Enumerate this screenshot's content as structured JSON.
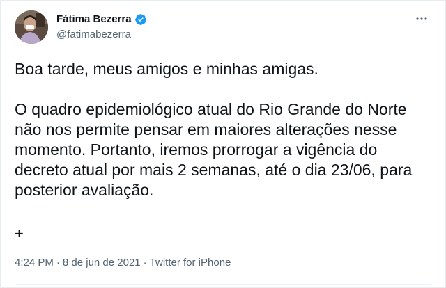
{
  "author": {
    "display_name": "Fátima Bezerra",
    "handle": "@fatimabezerra",
    "verified_icon": "verified-badge-icon",
    "avatar_icon": "avatar"
  },
  "tweet": {
    "paragraphs": [
      "Boa tarde, meus amigos e minhas amigas.",
      "O quadro epidemiológico atual do Rio Grande do Norte não nos permite pensar em maiores alterações nesse momento. Portanto, iremos prorrogar a vigência do decreto atual por mais 2 semanas, até o dia 23/06, para posterior avaliação."
    ],
    "thread_marker": "+"
  },
  "meta": {
    "time": "4:24 PM",
    "separator": "·",
    "date": "8 de jun de 2021",
    "source": "Twitter for iPhone"
  },
  "colors": {
    "verified_blue": "#1d9bf0",
    "secondary_text": "#536471",
    "primary_text": "#0f1419"
  }
}
